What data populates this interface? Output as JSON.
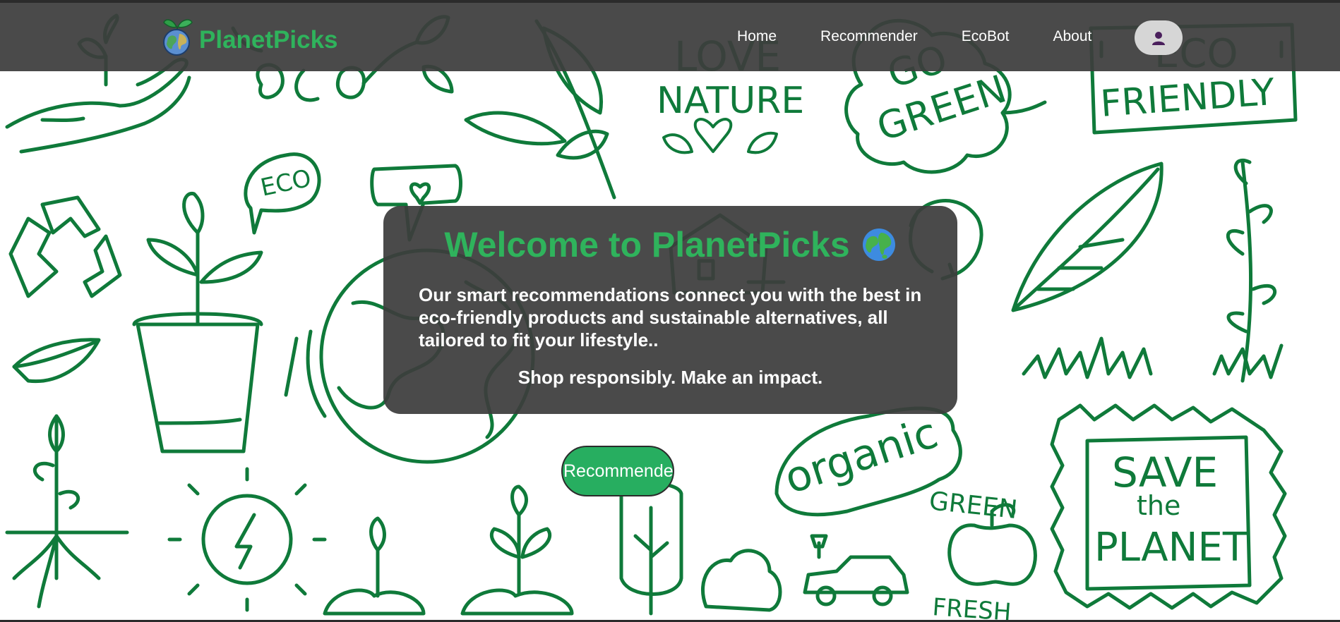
{
  "brand": {
    "name": "PlanetPicks",
    "logo_icon": "globe-with-leaves-icon"
  },
  "nav": {
    "items": [
      {
        "label": "Home"
      },
      {
        "label": "Recommender"
      },
      {
        "label": "EcoBot"
      },
      {
        "label": "About"
      }
    ],
    "profile_icon": "user-icon"
  },
  "hero": {
    "title": "Welcome to PlanetPicks",
    "title_icon": "globe-emoji",
    "description": "Our smart recommendations connect you with the best in eco-friendly products and sustainable alternatives, all tailored to fit your lifestyle..",
    "tagline": "Shop responsibly. Make an impact.",
    "cta_label": "Recommender"
  },
  "background": {
    "doodle_words": [
      "eco",
      "LOVE",
      "NATURE",
      "GO",
      "GREEN",
      "ECO",
      "FRIENDLY",
      "ECO",
      "organic",
      "GREEN",
      "FRESH",
      "SAVE",
      "the",
      "PLANET"
    ]
  },
  "colors": {
    "accent": "#2fb35c",
    "button": "#27ae60",
    "overlay": "#3c3c3c",
    "doodle": "#0f7a3a"
  }
}
